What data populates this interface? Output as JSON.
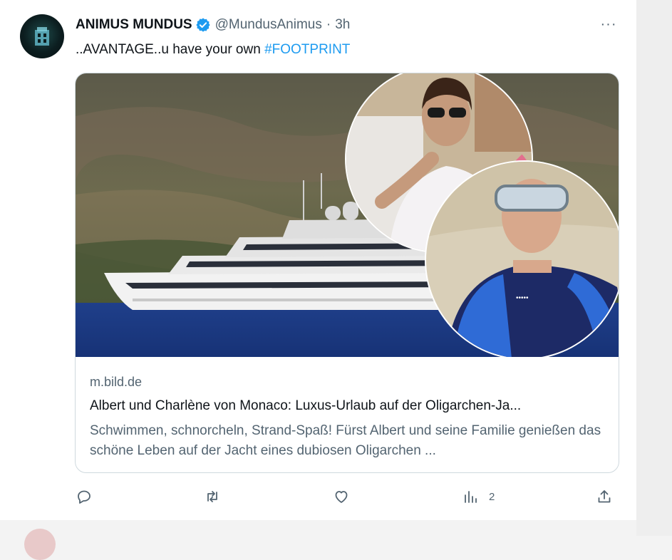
{
  "tweet": {
    "author_name": "ANIMUS MUNDUS",
    "handle": "@MundusAnimus",
    "separator": "·",
    "time": "3h",
    "more_label": "···",
    "text_prefix": "..AVANTAGE..u have your own ",
    "hashtag": "#FOOTPRINT"
  },
  "card": {
    "domain": "m.bild.de",
    "title": "Albert und Charlène von Monaco: Luxus-Urlaub auf der Oligarchen-Ja...",
    "description": "Schwimmen, schnorcheln, Strand-Spaß! Fürst Albert und seine Familie genießen das schöne Leben auf der Jacht eines dubiosen Oligarchen ..."
  },
  "actions": {
    "reply_icon": "reply-icon",
    "retweet_icon": "retweet-icon",
    "like_icon": "heart-icon",
    "views_icon": "views-icon",
    "views_count": "2",
    "share_icon": "share-icon"
  },
  "colors": {
    "accent": "#1d9bf0",
    "text": "#0f1419",
    "muted": "#536471",
    "border": "#cfd9de"
  }
}
